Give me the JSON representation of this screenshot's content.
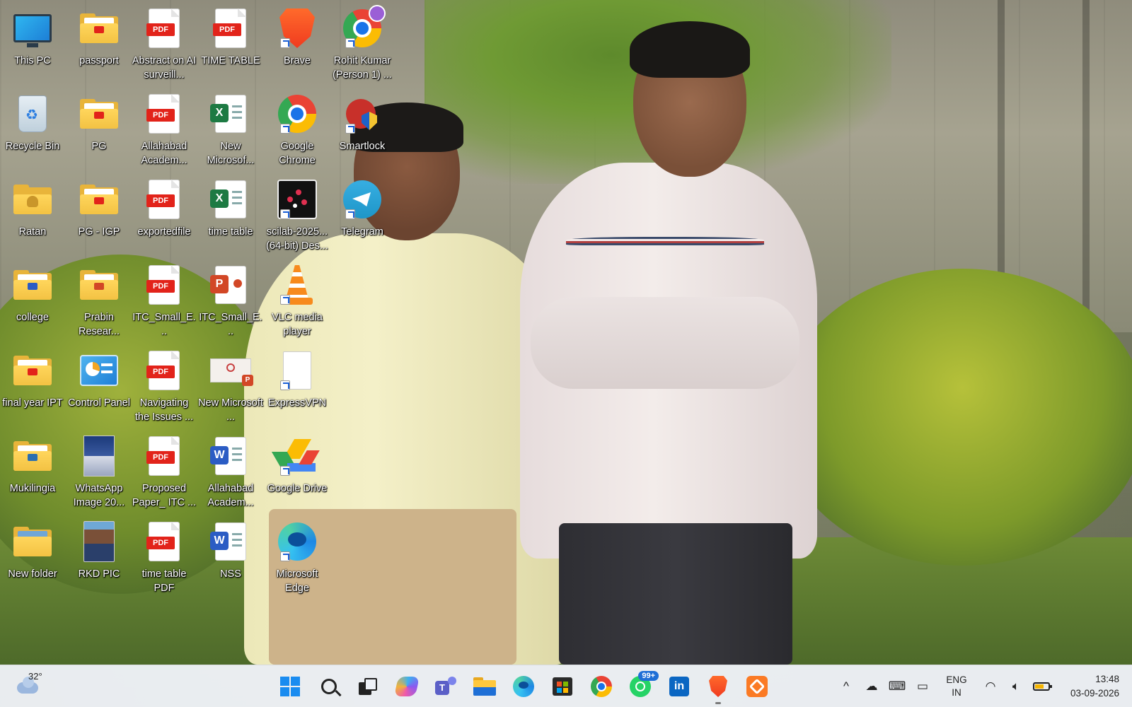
{
  "desktop": {
    "icons": [
      {
        "label": "This PC",
        "type": "monitor"
      },
      {
        "label": "Recycle Bin",
        "type": "bin"
      },
      {
        "label": "Ratan",
        "type": "folder-user"
      },
      {
        "label": "college",
        "type": "folder"
      },
      {
        "label": "final year IPT",
        "type": "folder"
      },
      {
        "label": "Mukilingia",
        "type": "folder"
      },
      {
        "label": "New folder",
        "type": "folder"
      },
      {
        "label": "passport",
        "type": "folder"
      },
      {
        "label": "PG",
        "type": "folder"
      },
      {
        "label": "PG - IGP",
        "type": "folder"
      },
      {
        "label": "Prabin Resear...",
        "type": "folder"
      },
      {
        "label": "Control Panel",
        "type": "control-panel"
      },
      {
        "label": "WhatsApp Image 20...",
        "type": "image"
      },
      {
        "label": "RKD PIC",
        "type": "photo"
      },
      {
        "label": "Abstract on AI surveill...",
        "type": "pdf"
      },
      {
        "label": "Allahabad Academ...",
        "type": "pdf"
      },
      {
        "label": "exportedfile",
        "type": "pdf"
      },
      {
        "label": "ITC_Small_E...",
        "type": "pdf"
      },
      {
        "label": "Navigating the Issues ...",
        "type": "pdf"
      },
      {
        "label": "Proposed Paper_ ITC ...",
        "type": "pdf"
      },
      {
        "label": "time table PDF",
        "type": "pdf"
      },
      {
        "label": "TIME TABLE",
        "type": "pdf"
      },
      {
        "label": "New Microsof...",
        "type": "excel"
      },
      {
        "label": "time table",
        "type": "excel"
      },
      {
        "label": "ITC_Small_E...",
        "type": "powerpoint"
      },
      {
        "label": "New Microsoft ...",
        "type": "powerpoint-image"
      },
      {
        "label": "Allahabad Academ...",
        "type": "word"
      },
      {
        "label": "NSS",
        "type": "word"
      },
      {
        "label": "Brave",
        "type": "brave"
      },
      {
        "label": "Google Chrome",
        "type": "chrome"
      },
      {
        "label": "scilab-2025... (64-bit) Des...",
        "type": "scilab"
      },
      {
        "label": "VLC media player",
        "type": "vlc"
      },
      {
        "label": "ExpressVPN",
        "type": "blank"
      },
      {
        "label": "Google Drive",
        "type": "drive"
      },
      {
        "label": "Microsoft Edge",
        "type": "edge"
      },
      {
        "label": "Rohit Kumar (Person 1) ...",
        "type": "chrome-profile"
      },
      {
        "label": "Smartlock",
        "type": "smartlock"
      },
      {
        "label": "Telegram",
        "type": "telegram"
      }
    ]
  },
  "taskbar": {
    "weather": {
      "temp": "32°",
      "icon": "cloud-icon"
    },
    "apps": [
      {
        "name": "start",
        "icon": "windows-icon"
      },
      {
        "name": "search",
        "icon": "search-icon"
      },
      {
        "name": "task-view",
        "icon": "task-view-icon"
      },
      {
        "name": "copilot",
        "icon": "copilot-icon"
      },
      {
        "name": "teams",
        "icon": "teams-icon"
      },
      {
        "name": "file-explorer",
        "icon": "folder-icon"
      },
      {
        "name": "edge",
        "icon": "edge-icon"
      },
      {
        "name": "store",
        "icon": "store-icon"
      },
      {
        "name": "chrome",
        "icon": "chrome-icon"
      },
      {
        "name": "whatsapp",
        "icon": "whatsapp-icon",
        "badge": "99+"
      },
      {
        "name": "linkedin",
        "icon": "linkedin-icon"
      },
      {
        "name": "brave",
        "icon": "brave-icon",
        "active": true
      },
      {
        "name": "xampp",
        "icon": "xampp-icon"
      }
    ],
    "tray": {
      "language": {
        "line1": "ENG",
        "line2": "IN"
      },
      "time": "13:48",
      "date": "03-09-2026"
    }
  },
  "colors": {
    "taskbar_bg": "#eef1f7",
    "pdf_red": "#e2231a",
    "excel_green": "#1d7a43",
    "word_blue": "#2b5cc4",
    "ppt_orange": "#d24726",
    "folder_yellow": "#ffd65c"
  }
}
